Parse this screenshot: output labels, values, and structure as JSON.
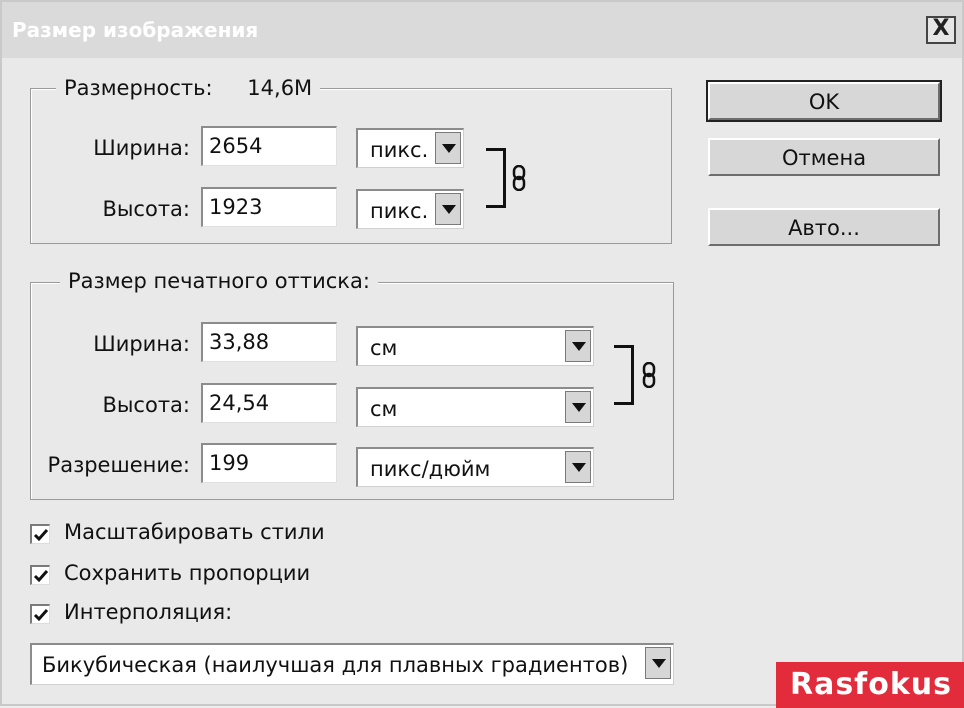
{
  "window": {
    "title": "Размер изображения",
    "close_label": "X"
  },
  "pixel_dimensions": {
    "legend": "Размерность:",
    "size": "14,6M",
    "width": {
      "label": "Ширина:",
      "value": "2654",
      "unit": "пикс."
    },
    "height": {
      "label": "Высота:",
      "value": "1923",
      "unit": "пикс."
    }
  },
  "document_size": {
    "legend": "Размер печатного оттиска:",
    "width": {
      "label": "Ширина:",
      "value": "33,88",
      "unit": "см"
    },
    "height": {
      "label": "Высота:",
      "value": "24,54",
      "unit": "см"
    },
    "resolution": {
      "label": "Разрешение:",
      "value": "199",
      "unit": "пикс/дюйм"
    }
  },
  "buttons": {
    "ok": "OK",
    "cancel": "Отмена",
    "auto": "Авто..."
  },
  "options": {
    "scale_styles": {
      "label": "Масштабировать стили",
      "checked": true
    },
    "constrain_proportions": {
      "label": "Сохранить пропорции",
      "checked": true
    },
    "resample": {
      "label": "Интерполяция:",
      "checked": true
    }
  },
  "interpolation": {
    "selected": "Бикубическая (наилучшая для плавных градиентов)"
  },
  "watermark": {
    "text": "Rasfokus"
  },
  "icons": {
    "link": "chain-link-icon",
    "check": "checkmark-icon",
    "dropdown": "chevron-down-icon"
  }
}
